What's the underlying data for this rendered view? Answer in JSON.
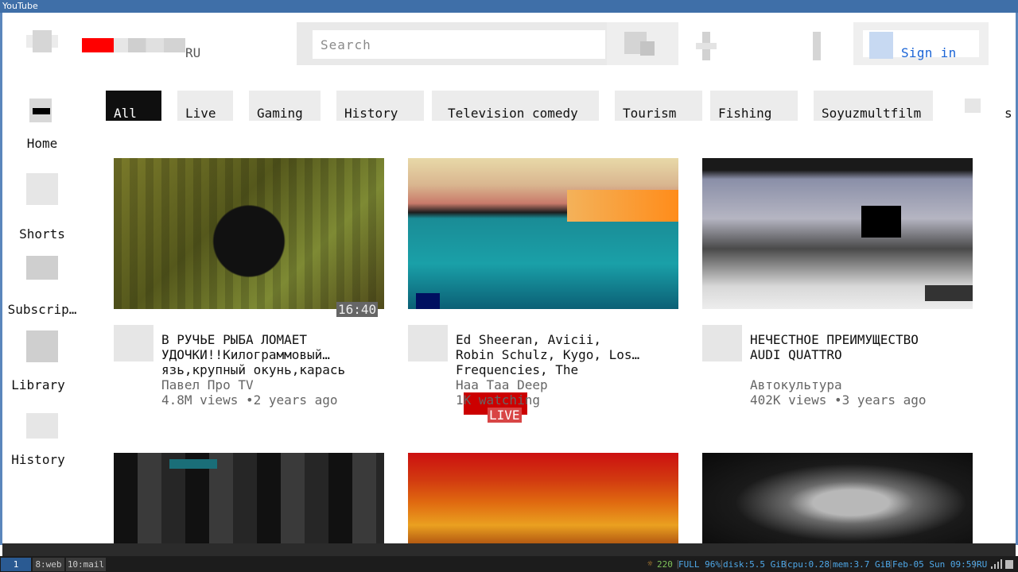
{
  "window": {
    "title": "YouTube"
  },
  "header": {
    "country_code": "RU",
    "search_placeholder": "Search",
    "sign_in_label": "Sign in",
    "icons": {
      "menu": "menu-icon",
      "search": "search-icon",
      "mic": "microphone-icon",
      "more": "more-vert-icon",
      "account": "account-icon"
    }
  },
  "sidebar": {
    "items": [
      {
        "label": "Home",
        "icon": "home-icon"
      },
      {
        "label": "Shorts",
        "icon": "shorts-icon"
      },
      {
        "label": "Subscrip…",
        "icon": "subscriptions-icon"
      },
      {
        "label": "Library",
        "icon": "library-icon"
      },
      {
        "label": "History",
        "icon": "history-icon"
      }
    ]
  },
  "chips": {
    "items": [
      {
        "label": "All",
        "selected": true
      },
      {
        "label": "Live"
      },
      {
        "label": "Gaming"
      },
      {
        "label": "History"
      },
      {
        "label": "Television comedy"
      },
      {
        "label": "Tourism"
      },
      {
        "label": "Fishing"
      },
      {
        "label": "Soyuzmultfilm"
      },
      {
        "label": "s"
      }
    ]
  },
  "videos": [
    {
      "title_lines": [
        "В РУЧЬЕ РЫБА ЛОМАЕТ",
        "УДОЧКИ!!Килограммовый…",
        "язь,крупный окунь,карась"
      ],
      "channel": "Павел Про TV",
      "stats": "4.8M views •2 years ago",
      "duration": "16:40"
    },
    {
      "title_lines": [
        "Ed Sheeran, Avicii,",
        "Robin Schulz, Kygo, Los…",
        "Frequencies, The"
      ],
      "channel": "Haa Taa Deep",
      "stats": "1K watching",
      "badge": "LIVE"
    },
    {
      "title_lines": [
        "НЕЧЕСТНОЕ ПРЕИМУЩЕСТВО",
        "AUDI QUATTRO"
      ],
      "channel": "Автокультура",
      "stats": "402K views •3 years ago"
    }
  ],
  "taskbar": {
    "workspaces": [
      "1",
      "8:web",
      "10:mail"
    ],
    "status": {
      "brightness": "220",
      "battery": "FULL 96%",
      "disk": "disk:5.5 GiB",
      "cpu": "cpu:0.28",
      "mem": "mem:3.7 GiB",
      "datetime": "Feb-05 Sun 09:59",
      "layout": "RU"
    }
  },
  "colors": {
    "brand_red": "#ff0000",
    "link_blue": "#1a64d6",
    "live_red": "#cc0000",
    "titlebar": "#3f6fa8",
    "taskbar": "#1c1c1c"
  }
}
